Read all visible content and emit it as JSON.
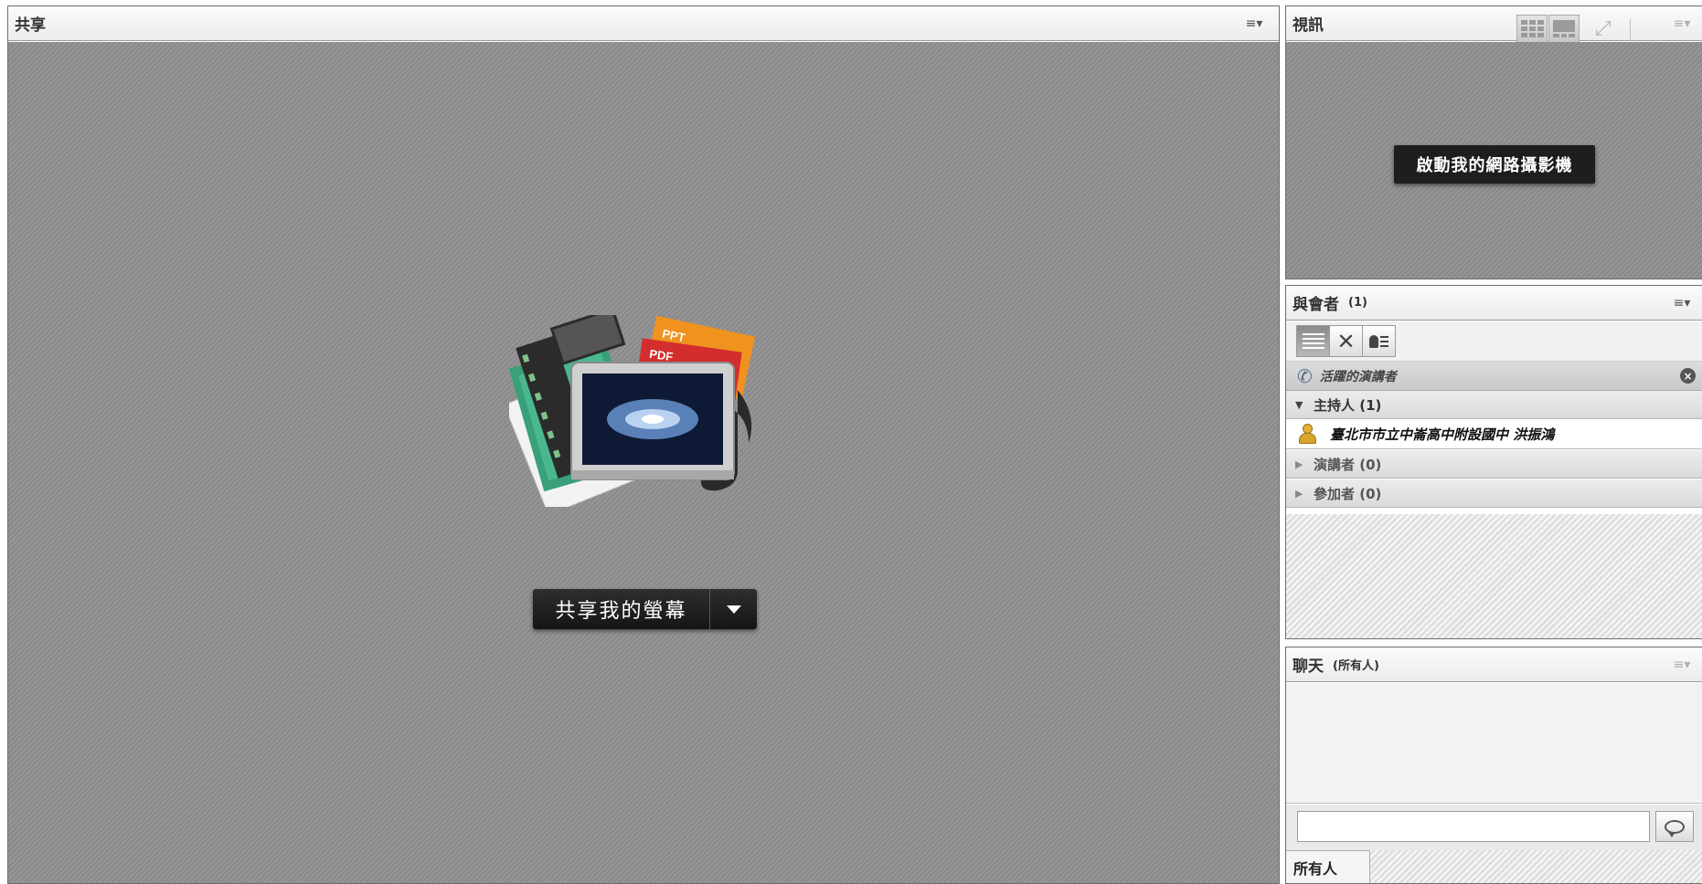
{
  "share": {
    "title": "共享",
    "menu_icon": "≡▾",
    "art_labels": {
      "ppt": "PPT",
      "pdf": "PDF"
    },
    "share_button_label": "共享我的螢幕"
  },
  "video": {
    "title": "視訊",
    "menu_icon": "≡▾",
    "webcam_button_label": "啟動我的網路攝影機"
  },
  "attendees": {
    "title": "與會者",
    "count": "(1)",
    "menu_icon": "≡▾",
    "active_speakers_label": "活躍的演講者",
    "groups": {
      "hosts": "主持人 (1)",
      "presenters": "演講者 (0)",
      "participants": "參加者 (0)"
    },
    "host_name": "臺北市市立中崙高中附設國中 洪振鴻"
  },
  "chat": {
    "title": "聊天",
    "scope": "(所有人)",
    "menu_icon": "≡▾",
    "input_value": "",
    "tab_label": "所有人"
  },
  "colors": {
    "share_bg": "#8f8f8f",
    "dark_button": "#1e1e1e",
    "header_bg": "#f2f2f2",
    "host_icon": "#d9a42a"
  }
}
